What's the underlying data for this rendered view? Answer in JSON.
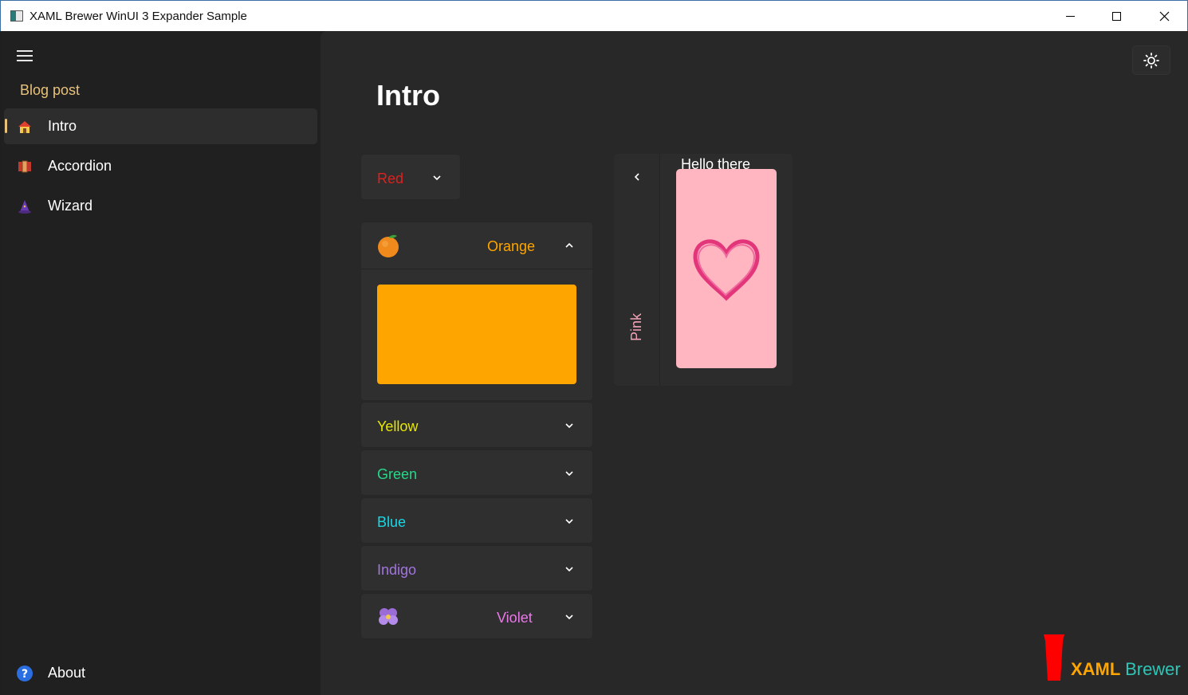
{
  "window": {
    "title": "XAML Brewer WinUI 3 Expander Sample"
  },
  "sidebar": {
    "section_header": "Blog post",
    "items": [
      {
        "label": "Intro",
        "icon": "house-icon",
        "selected": true
      },
      {
        "label": "Accordion",
        "icon": "accordion-icon",
        "selected": false
      },
      {
        "label": "Wizard",
        "icon": "wizard-icon",
        "selected": false
      }
    ],
    "footer_item": {
      "label": "About",
      "icon": "help-icon"
    }
  },
  "main": {
    "title": "Intro",
    "expanders": [
      {
        "label": "Red",
        "color": "#e0201c",
        "expanded": false
      },
      {
        "label": "Orange",
        "color": "#ffa500",
        "expanded": true,
        "icon": "orange-fruit-icon",
        "content_color": "#ffa500"
      },
      {
        "label": "Yellow",
        "color": "#e8e800",
        "expanded": false
      },
      {
        "label": "Green",
        "color": "#28d88a",
        "expanded": false
      },
      {
        "label": "Blue",
        "color": "#1ad7e6",
        "expanded": false
      },
      {
        "label": "Indigo",
        "color": "#a275e0",
        "expanded": false
      },
      {
        "label": "Violet",
        "color": "#e87ae8",
        "expanded": false,
        "icon": "pansy-flower-icon"
      }
    ],
    "pink_expander": {
      "label": "Pink",
      "color": "#f2a2b6",
      "header_text": "Hello there",
      "panel_color": "#ffb6c1",
      "icon": "heart-icon"
    }
  },
  "branding": {
    "word1": "XAML",
    "word2": "Brewer",
    "colors": {
      "cup": "#ff0000",
      "word1": "#ffa500",
      "word2": "#2ec4b6"
    }
  }
}
